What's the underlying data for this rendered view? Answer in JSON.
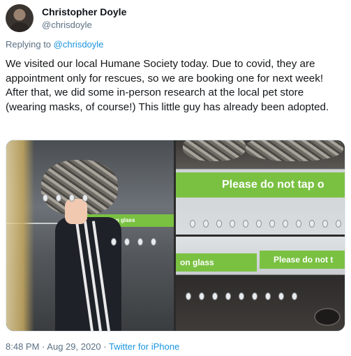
{
  "author": {
    "name": "Christopher Doyle",
    "handle": "@chrisdoyle"
  },
  "reply": {
    "prefix": "Replying to",
    "to": "@chrisdoyle"
  },
  "tweet": {
    "text": "We visited our local Humane Society today. Due to covid, they are appointment only for rescues, so we are booking one for next week! After that, we did some in-person research at the local pet store (wearing masks, of course!) This little guy has already been adopted."
  },
  "media": {
    "photo1_sign": "o not tap on glass",
    "photo2_sign": "Please do not tap o",
    "photo3_sign_left": "on glass",
    "photo3_sign_right": "Please do not t"
  },
  "footer": {
    "time": "8:48 PM",
    "separator": "·",
    "date": "Aug 29, 2020",
    "source": "Twitter for iPhone"
  }
}
